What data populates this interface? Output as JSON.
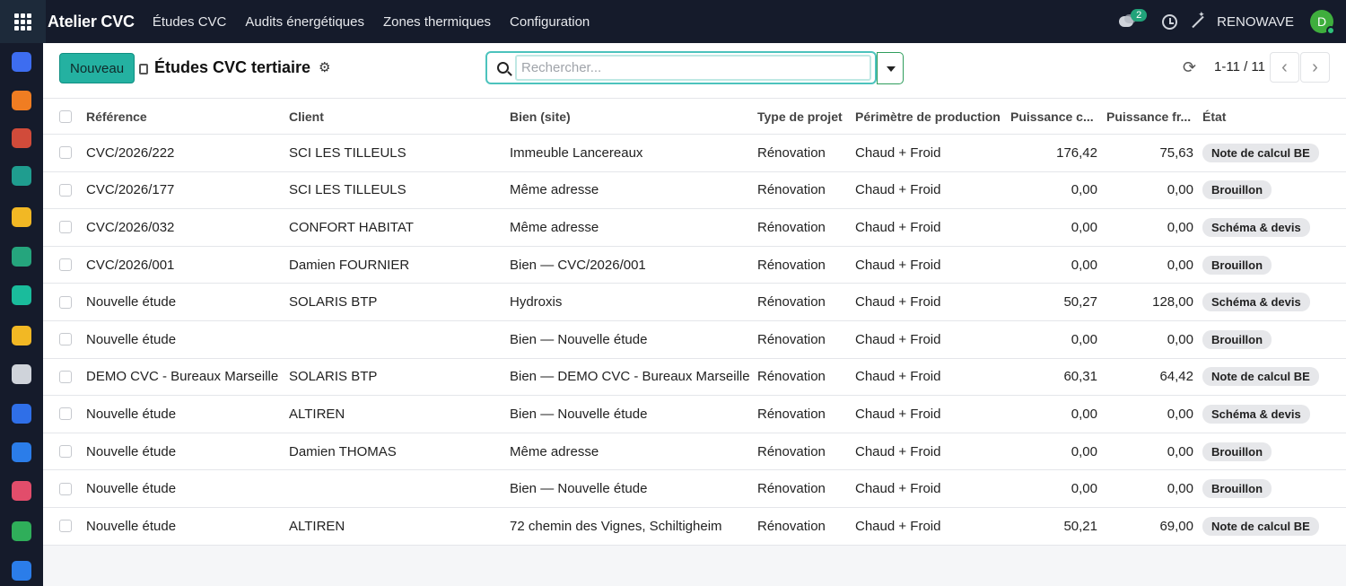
{
  "app": {
    "brand": "Atelier CVC",
    "menu": [
      "Études CVC",
      "Audits énergétiques",
      "Zones thermiques",
      "Configuration"
    ],
    "messages_count": "2",
    "company": "RENOWAVE",
    "avatar_initial": "D"
  },
  "rail_icons": [
    {
      "name": "app-blue-icon",
      "color": "#3d6df0"
    },
    {
      "name": "app-orange-icon",
      "color": "#f07d22"
    },
    {
      "name": "calendar-31-icon",
      "color": "#d14b3a"
    },
    {
      "name": "pen-icon",
      "color": "#1f9d8f"
    },
    {
      "name": "disc-icon",
      "color": "#f2b824"
    },
    {
      "name": "contacts-icon",
      "color": "#25a57d"
    },
    {
      "name": "triangle-icon",
      "color": "#1abc9c"
    },
    {
      "name": "disc-2-icon",
      "color": "#f2b824"
    },
    {
      "name": "bank-icon",
      "color": "#cfd3da"
    },
    {
      "name": "app-square-blue-icon",
      "color": "#2f6fe8"
    },
    {
      "name": "calendar-icon",
      "color": "#2b7de9"
    },
    {
      "name": "dashboard-icon",
      "color": "#e24d6b"
    },
    {
      "name": "app-green-icon",
      "color": "#2fae5a"
    },
    {
      "name": "calendar-2-icon",
      "color": "#2b7de9"
    }
  ],
  "control": {
    "new_label": "Nouveau",
    "title": "Études CVC tertiaire",
    "search_placeholder": "Rechercher...",
    "pager": "1-11 / 11"
  },
  "table": {
    "headers": [
      "Référence",
      "Client",
      "Bien (site)",
      "Type de projet",
      "Périmètre de production",
      "Puissance c...",
      "Puissance fr...",
      "État"
    ],
    "rows": [
      {
        "ref": "CVC/2026/222",
        "client": "SCI LES TILLEULS",
        "site": "Immeuble Lancereaux",
        "type": "Rénovation",
        "scope": "Chaud + Froid",
        "p_chaud": "176,42",
        "p_froid": "75,63",
        "state": "Note de calcul BE"
      },
      {
        "ref": "CVC/2026/177",
        "client": "SCI LES TILLEULS",
        "site": "Même adresse",
        "type": "Rénovation",
        "scope": "Chaud + Froid",
        "p_chaud": "0,00",
        "p_froid": "0,00",
        "state": "Brouillon"
      },
      {
        "ref": "CVC/2026/032",
        "client": "CONFORT HABITAT",
        "site": "Même adresse",
        "type": "Rénovation",
        "scope": "Chaud + Froid",
        "p_chaud": "0,00",
        "p_froid": "0,00",
        "state": "Schéma & devis"
      },
      {
        "ref": "CVC/2026/001",
        "client": "Damien FOURNIER",
        "site": "Bien — CVC/2026/001",
        "type": "Rénovation",
        "scope": "Chaud + Froid",
        "p_chaud": "0,00",
        "p_froid": "0,00",
        "state": "Brouillon"
      },
      {
        "ref": "Nouvelle étude",
        "client": "SOLARIS BTP",
        "site": "Hydroxis",
        "type": "Rénovation",
        "scope": "Chaud + Froid",
        "p_chaud": "50,27",
        "p_froid": "128,00",
        "state": "Schéma & devis"
      },
      {
        "ref": "Nouvelle étude",
        "client": "",
        "site": "Bien — Nouvelle étude",
        "type": "Rénovation",
        "scope": "Chaud + Froid",
        "p_chaud": "0,00",
        "p_froid": "0,00",
        "state": "Brouillon"
      },
      {
        "ref": "DEMO CVC - Bureaux Marseille",
        "client": "SOLARIS BTP",
        "site": "Bien — DEMO CVC - Bureaux Marseille",
        "type": "Rénovation",
        "scope": "Chaud + Froid",
        "p_chaud": "60,31",
        "p_froid": "64,42",
        "state": "Note de calcul BE"
      },
      {
        "ref": "Nouvelle étude",
        "client": "ALTIREN",
        "site": "Bien — Nouvelle étude",
        "type": "Rénovation",
        "scope": "Chaud + Froid",
        "p_chaud": "0,00",
        "p_froid": "0,00",
        "state": "Schéma & devis"
      },
      {
        "ref": "Nouvelle étude",
        "client": "Damien THOMAS",
        "site": "Même adresse",
        "type": "Rénovation",
        "scope": "Chaud + Froid",
        "p_chaud": "0,00",
        "p_froid": "0,00",
        "state": "Brouillon"
      },
      {
        "ref": "Nouvelle étude",
        "client": "",
        "site": "Bien — Nouvelle étude",
        "type": "Rénovation",
        "scope": "Chaud + Froid",
        "p_chaud": "0,00",
        "p_froid": "0,00",
        "state": "Brouillon"
      },
      {
        "ref": "Nouvelle étude",
        "client": "ALTIREN",
        "site": "72 chemin des Vignes, Schiltigheim",
        "type": "Rénovation",
        "scope": "Chaud + Froid",
        "p_chaud": "50,21",
        "p_froid": "69,00",
        "state": "Note de calcul BE"
      }
    ]
  }
}
